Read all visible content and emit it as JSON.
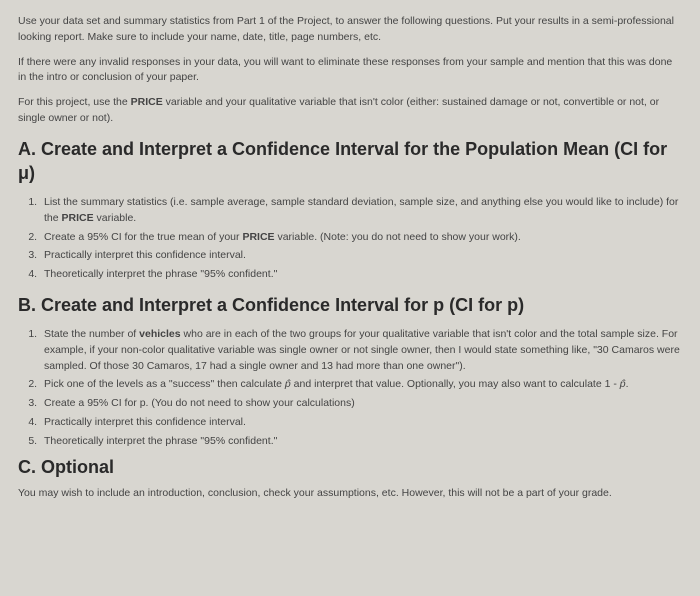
{
  "intro": {
    "p1": "Use your data set and summary statistics from Part 1 of the Project, to answer the following questions. Put your results in a semi-professional looking report. Make sure to include your name, date, title, page numbers, etc.",
    "p2": "If there were any invalid responses in your data, you will want to eliminate these responses from your sample and mention that this was done in the intro or conclusion of your paper.",
    "p3_pre": "For this project, use the ",
    "p3_bold": "PRICE",
    "p3_post": " variable and your qualitative variable that isn't color (either: sustained damage or not, convertible or not, or single owner or not)."
  },
  "sectionA": {
    "heading": "A. Create and Interpret a Confidence Interval for the Population Mean (CI for μ)",
    "items": {
      "i1_pre": "List the summary statistics (i.e. sample average, sample standard deviation, sample size, and anything else you would like to include) for the ",
      "i1_bold": "PRICE",
      "i1_post": " variable.",
      "i2_pre": "Create a 95% CI for the true mean of your ",
      "i2_bold": "PRICE",
      "i2_post": " variable. (Note: you do not need to show your work).",
      "i3": "Practically interpret this confidence interval.",
      "i4": "Theoretically interpret the phrase \"95% confident.\""
    }
  },
  "sectionB": {
    "heading": "B. Create and Interpret a Confidence Interval for p (CI for p)",
    "items": {
      "i1_pre": "State the number of ",
      "i1_bold": "vehicles",
      "i1_post": " who are in each of the two groups for your qualitative variable that isn't color and the total sample size. For example, if your non-color qualitative variable was single owner or not single owner, then I would state something like, \"30 Camaros were sampled. Of those 30 Camaros, 17 had a single owner and 13 had more than one owner\").",
      "i2_pre": "Pick one of the levels as a \"success\" then calculate ",
      "i2_mid": " and interpret that value. Optionally, you may also want to calculate 1 - ",
      "i2_post": ".",
      "phat": "p̂",
      "i3": "Create a 95% CI for p. (You do not need to show your calculations)",
      "i4": "Practically interpret this confidence interval.",
      "i5": "Theoretically interpret the phrase \"95% confident.\""
    }
  },
  "sectionC": {
    "heading": "C. Optional",
    "text": "You may wish to include an introduction, conclusion, check your assumptions, etc. However, this will not be a part of your grade."
  }
}
